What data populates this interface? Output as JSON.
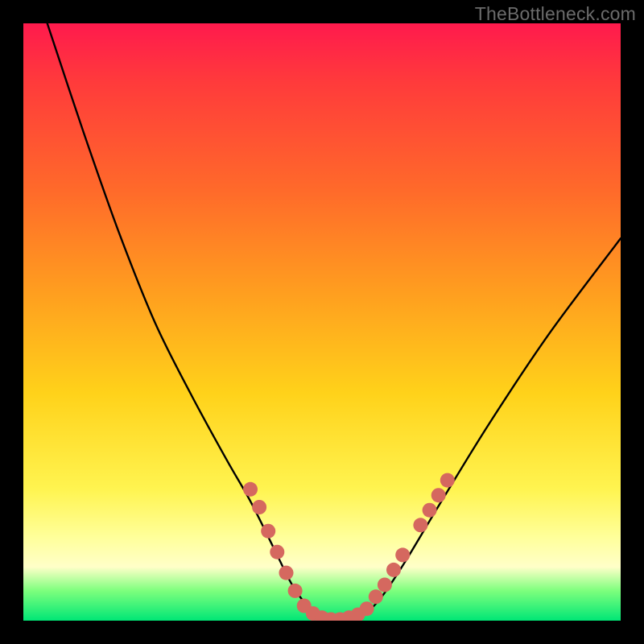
{
  "watermark": "TheBottleneck.com",
  "chart_data": {
    "type": "line",
    "title": "",
    "xlabel": "",
    "ylabel": "",
    "xlim": [
      0,
      100
    ],
    "ylim": [
      0,
      100
    ],
    "grid": false,
    "legend": false,
    "gradient_stops": [
      {
        "pos": 0,
        "color": "#ff1a4d"
      },
      {
        "pos": 10,
        "color": "#ff3b3b"
      },
      {
        "pos": 28,
        "color": "#ff6a2a"
      },
      {
        "pos": 45,
        "color": "#ff9e1f"
      },
      {
        "pos": 62,
        "color": "#ffd21a"
      },
      {
        "pos": 78,
        "color": "#fff450"
      },
      {
        "pos": 86,
        "color": "#ffff9a"
      },
      {
        "pos": 91,
        "color": "#ffffc8"
      },
      {
        "pos": 95,
        "color": "#7dff7d"
      },
      {
        "pos": 100,
        "color": "#00e676"
      }
    ],
    "series": [
      {
        "name": "bottleneck-curve",
        "x": [
          4,
          10,
          16,
          22,
          28,
          34,
          38,
          42,
          45,
          48,
          51,
          54,
          57,
          60,
          64,
          70,
          78,
          88,
          100
        ],
        "values": [
          100,
          82,
          65,
          50,
          38,
          27,
          20,
          12,
          6,
          2,
          0,
          0,
          1,
          4,
          10,
          20,
          33,
          48,
          64
        ]
      }
    ],
    "markers": [
      {
        "x": 38.0,
        "y": 22.0
      },
      {
        "x": 39.5,
        "y": 19.0
      },
      {
        "x": 41.0,
        "y": 15.0
      },
      {
        "x": 42.5,
        "y": 11.5
      },
      {
        "x": 44.0,
        "y": 8.0
      },
      {
        "x": 45.5,
        "y": 5.0
      },
      {
        "x": 47.0,
        "y": 2.5
      },
      {
        "x": 48.5,
        "y": 1.2
      },
      {
        "x": 50.0,
        "y": 0.5
      },
      {
        "x": 51.5,
        "y": 0.2
      },
      {
        "x": 53.0,
        "y": 0.2
      },
      {
        "x": 54.5,
        "y": 0.5
      },
      {
        "x": 56.0,
        "y": 1.0
      },
      {
        "x": 57.5,
        "y": 2.0
      },
      {
        "x": 59.0,
        "y": 4.0
      },
      {
        "x": 60.5,
        "y": 6.0
      },
      {
        "x": 62.0,
        "y": 8.5
      },
      {
        "x": 63.5,
        "y": 11.0
      },
      {
        "x": 66.5,
        "y": 16.0
      },
      {
        "x": 68.0,
        "y": 18.5
      },
      {
        "x": 69.5,
        "y": 21.0
      },
      {
        "x": 71.0,
        "y": 23.5
      }
    ],
    "marker_style": {
      "color": "#d5685f",
      "radius_px": 9
    }
  }
}
